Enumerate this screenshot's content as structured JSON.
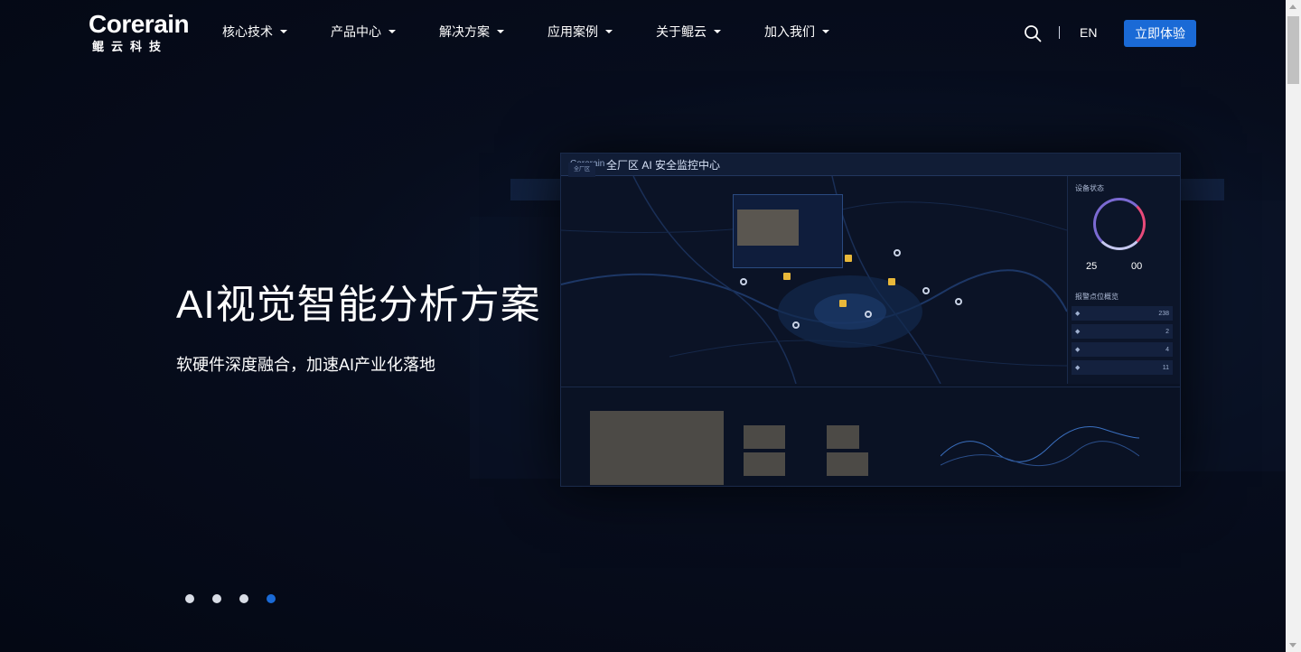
{
  "header": {
    "logo_word": "Corerain",
    "logo_cn": "鲲云科技",
    "nav": [
      {
        "label": "核心技术"
      },
      {
        "label": "产品中心"
      },
      {
        "label": "解决方案"
      },
      {
        "label": "应用案例"
      },
      {
        "label": "关于鲲云"
      },
      {
        "label": "加入我们"
      }
    ],
    "lang": "EN",
    "cta": "立即体验",
    "search_icon": "search-icon"
  },
  "hero": {
    "title": "AI视觉智能分析方案",
    "subtitle": "软硬件深度融合，加速AI产业化落地",
    "dashboard": {
      "logo": "Corerain",
      "title": "全厂区 AI 安全监控中心",
      "right_title": "设备状态",
      "right_title2": "报警点位概览",
      "stat1": "25",
      "stat2": "00",
      "alarm_values": [
        "238",
        "2",
        "4",
        "11"
      ],
      "tree_root": "全厂区"
    }
  },
  "carousel": {
    "count": 4,
    "active_index": 3
  },
  "colors": {
    "accent": "#1a6ad6",
    "background": "#050a18"
  }
}
